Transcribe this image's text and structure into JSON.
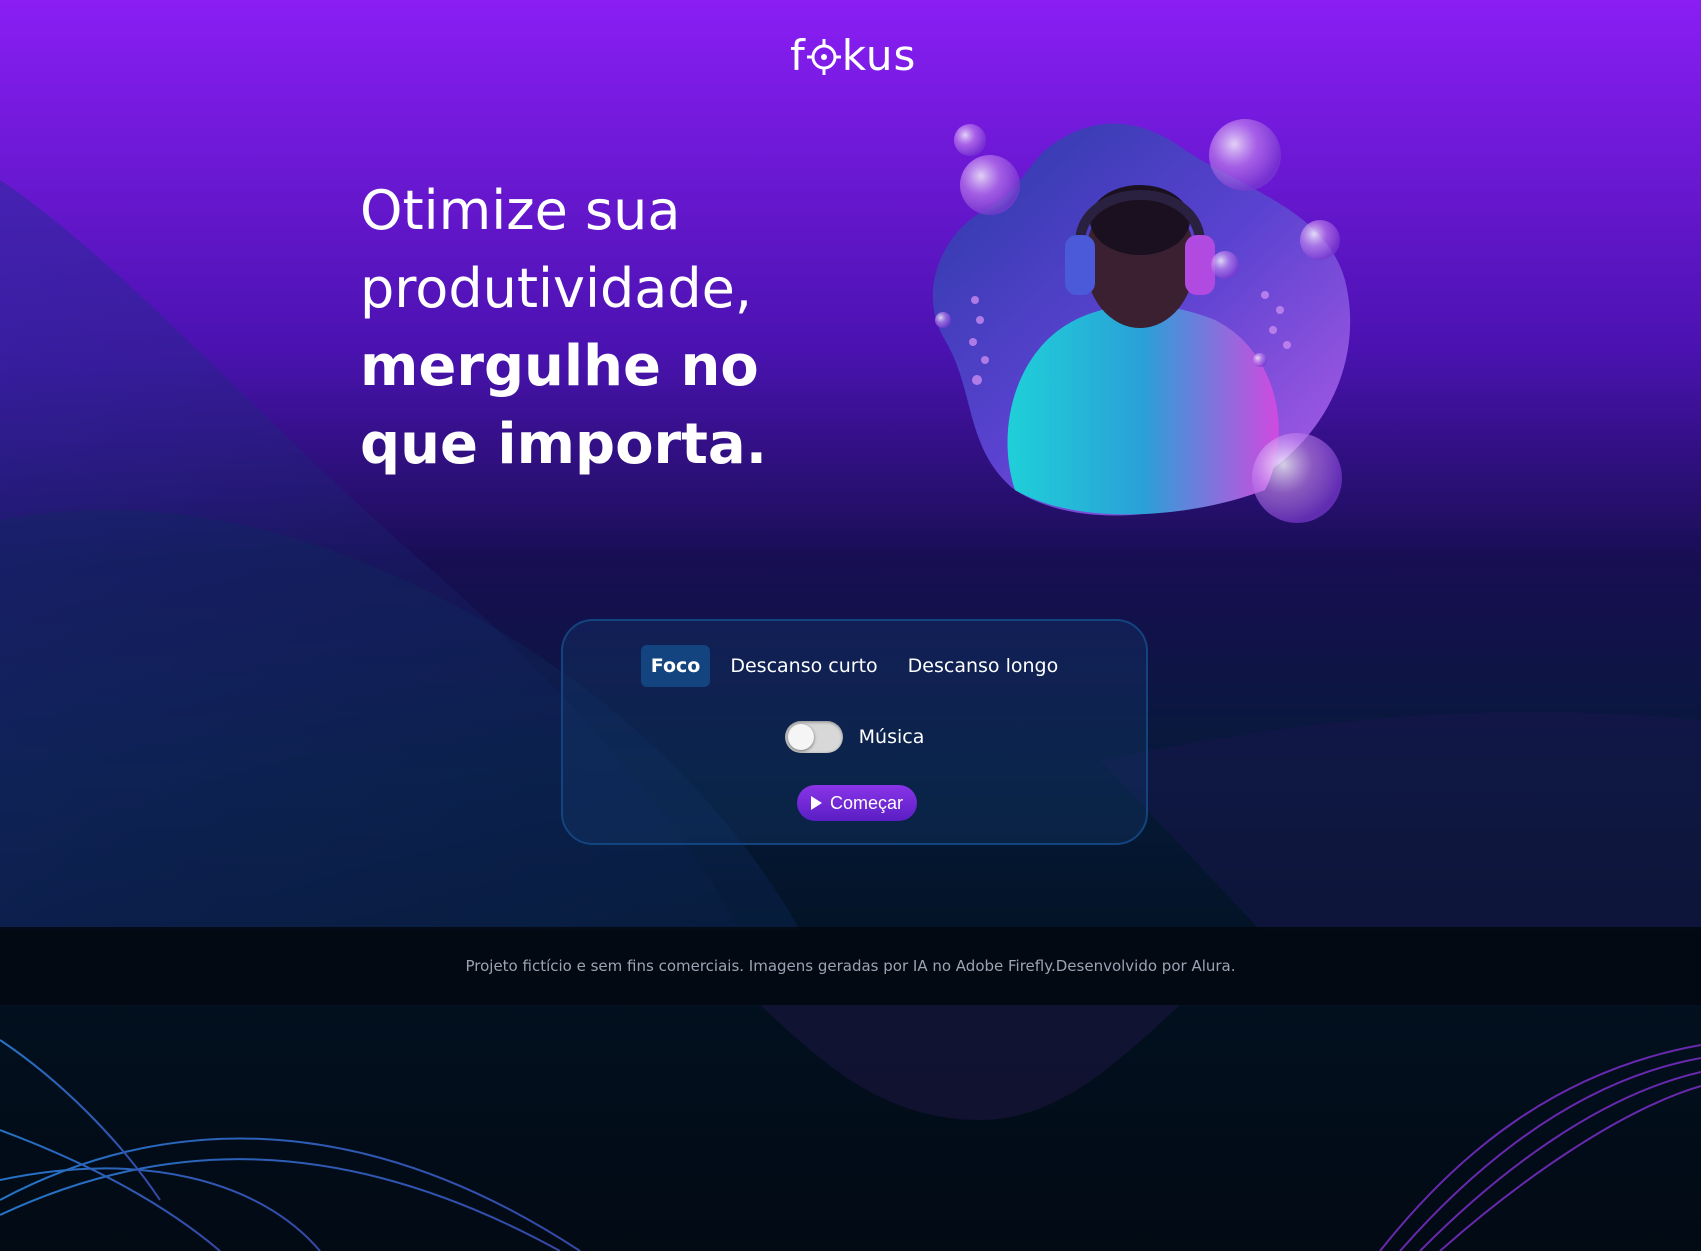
{
  "app": {
    "logo_prefix": "f",
    "logo_suffix": "kus"
  },
  "hero": {
    "line1": "Otimize sua",
    "line2": "produtividade,",
    "line3": "mergulhe no",
    "line4": "que importa."
  },
  "timer_card": {
    "tabs": [
      {
        "label": "Foco",
        "active": true
      },
      {
        "label": "Descanso curto",
        "active": false
      },
      {
        "label": "Descanso longo",
        "active": false
      }
    ],
    "music_label": "Música",
    "music_enabled": false,
    "start_label": "Começar"
  },
  "footer": {
    "text": "Projeto fictício e sem fins comerciais. Imagens geradas por IA no Adobe Firefly.Desenvolvido por Alura."
  },
  "colors": {
    "top_gradient": "#8a1ef4",
    "dark_bg": "#020a14",
    "tab_active": "#144480",
    "button": "#7a2ee0"
  }
}
